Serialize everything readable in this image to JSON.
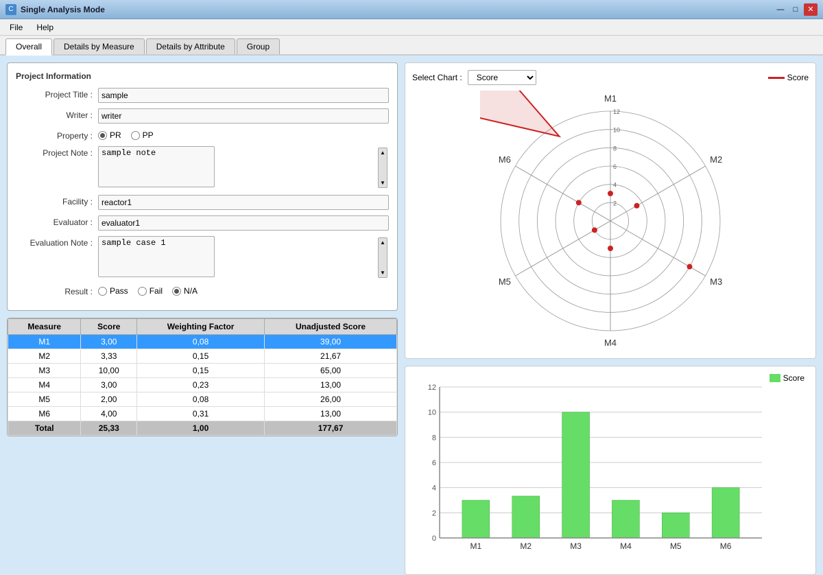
{
  "titleBar": {
    "icon": "C",
    "title": "Single Analysis Mode",
    "minimize": "—",
    "maximize": "□",
    "close": "✕"
  },
  "menu": {
    "items": [
      "File",
      "Help"
    ]
  },
  "tabs": [
    {
      "label": "Overall",
      "active": true
    },
    {
      "label": "Details by Measure",
      "active": false
    },
    {
      "label": "Details by Attribute",
      "active": false
    },
    {
      "label": "Group",
      "active": false
    }
  ],
  "projectInfo": {
    "title": "Project Information",
    "fields": {
      "projectTitle": {
        "label": "Project Title :",
        "value": "sample"
      },
      "writer": {
        "label": "Writer :",
        "value": "writer"
      },
      "property": {
        "label": "Property :",
        "options": [
          "PR",
          "PP"
        ],
        "selected": "PR"
      },
      "projectNote": {
        "label": "Project Note :",
        "value": "sample note"
      },
      "facility": {
        "label": "Facility :",
        "value": "reactor1"
      },
      "evaluator": {
        "label": "Evaluator :",
        "value": "evaluator1"
      },
      "evaluationNote": {
        "label": "Evaluation Note :",
        "value": "sample case 1"
      },
      "result": {
        "label": "Result :",
        "options": [
          "Pass",
          "Fail",
          "N/A"
        ],
        "selected": "N/A"
      }
    }
  },
  "table": {
    "headers": [
      "Measure",
      "Score",
      "Weighting Factor",
      "Unadjusted Score"
    ],
    "rows": [
      {
        "measure": "M1",
        "score": "3,00",
        "weight": "0,08",
        "unadjusted": "39,00",
        "selected": true
      },
      {
        "measure": "M2",
        "score": "3,33",
        "weight": "0,15",
        "unadjusted": "21,67",
        "selected": false
      },
      {
        "measure": "M3",
        "score": "10,00",
        "weight": "0,15",
        "unadjusted": "65,00",
        "selected": false
      },
      {
        "measure": "M4",
        "score": "3,00",
        "weight": "0,23",
        "unadjusted": "13,00",
        "selected": false
      },
      {
        "measure": "M5",
        "score": "2,00",
        "weight": "0,08",
        "unadjusted": "26,00",
        "selected": false
      },
      {
        "measure": "M6",
        "score": "4,00",
        "weight": "0,31",
        "unadjusted": "13,00",
        "selected": false
      }
    ],
    "total": {
      "measure": "Total",
      "score": "25,33",
      "weight": "1,00",
      "unadjusted": "177,67"
    }
  },
  "radarChart": {
    "selectLabel": "Select Chart :",
    "selectValue": "Score",
    "legendLabel": "Score",
    "legendColor": "#cc2222",
    "labels": [
      "M1",
      "M2",
      "M3",
      "M4",
      "M5",
      "M6"
    ],
    "values": [
      3,
      3.33,
      10,
      3,
      2,
      4
    ],
    "maxValue": 12,
    "rings": [
      2,
      4,
      6,
      8,
      10,
      12
    ]
  },
  "barChart": {
    "legendLabel": "Score",
    "legendColor": "#66dd66",
    "labels": [
      "M1",
      "M2",
      "M3",
      "M4",
      "M5",
      "M6"
    ],
    "values": [
      3,
      3.33,
      10,
      3,
      2,
      4
    ],
    "yAxis": [
      0,
      2,
      4,
      6,
      8,
      10,
      12
    ],
    "maxValue": 12
  },
  "colors": {
    "accent": "#3399ff",
    "radarLine": "#cc2222",
    "barFill": "#66dd66",
    "selectedRow": "#3399ff"
  }
}
